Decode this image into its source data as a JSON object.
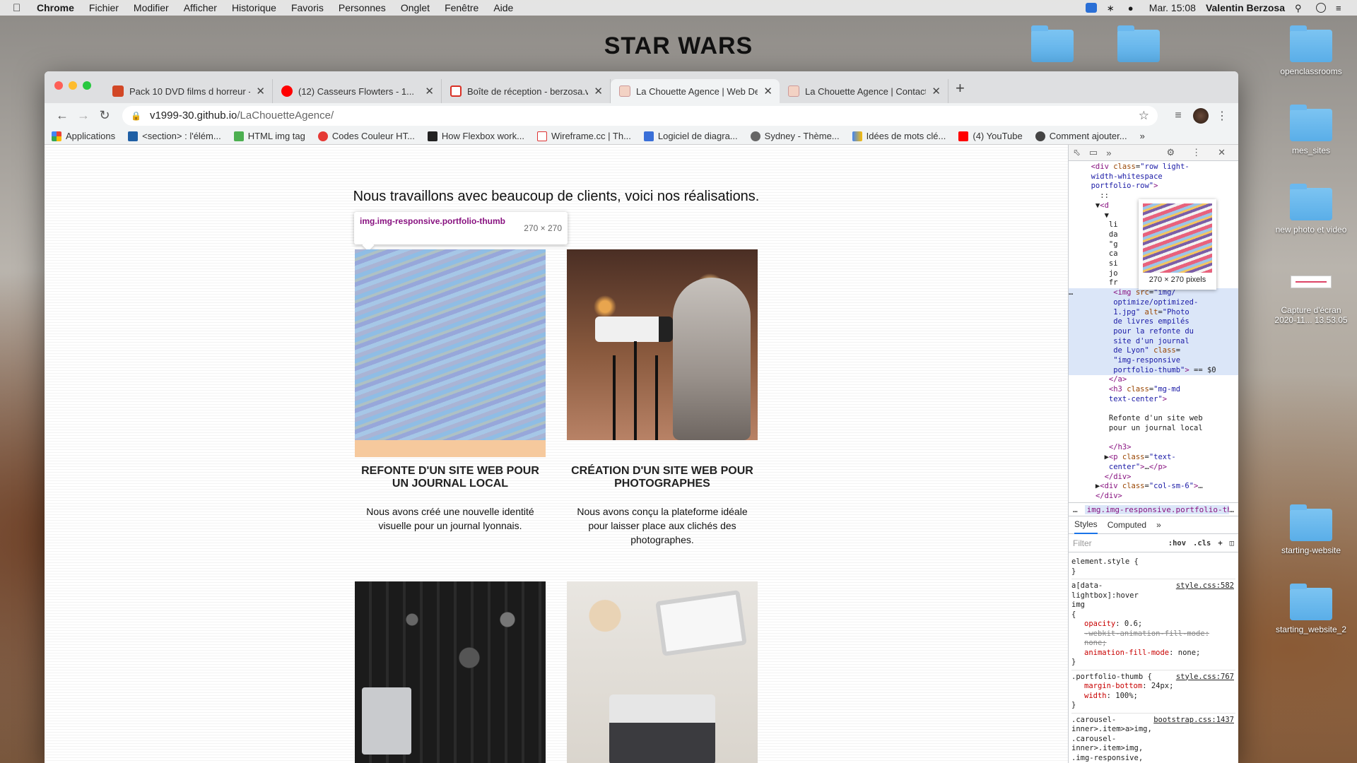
{
  "menubar": {
    "app": "Chrome",
    "items": [
      "Fichier",
      "Modifier",
      "Afficher",
      "Historique",
      "Favoris",
      "Personnes",
      "Onglet",
      "Fenêtre",
      "Aide"
    ],
    "clock": "Mar. 15:08",
    "user": "Valentin Berzosa"
  },
  "desktop": {
    "banner": "STAR WARS",
    "icons": [
      "openclassrooms",
      "mes_sites",
      "new photo et video",
      "Capture d'écran 2020-11... 13.53.05",
      "starting-website",
      "starting_website_2"
    ]
  },
  "browser": {
    "tabs": [
      {
        "title": "Pack 10 DVD films d horreur - 1",
        "favicon": "ppt"
      },
      {
        "title": "(12) Casseurs Flowters - 1...",
        "favicon": "youtube"
      },
      {
        "title": "Boîte de réception - berzosa.v",
        "favicon": "gmail"
      },
      {
        "title": "La Chouette Agence | Web De",
        "favicon": "owl"
      },
      {
        "title": "La Chouette Agence | Contact",
        "favicon": "owl"
      }
    ],
    "url_host": "v1999-30.github.io",
    "url_path": "/LaChouetteAgence/",
    "bookmarks": [
      "Applications",
      "<section> : l'élém...",
      "HTML img tag",
      "Codes Couleur HT...",
      "How Flexbox work...",
      "Wireframe.cc | Th...",
      "Logiciel de diagra...",
      "Sydney - Thème...",
      "Idées de mots clé...",
      "(4) YouTube",
      "Comment ajouter..."
    ]
  },
  "page": {
    "heading": "Nous travaillons avec beaucoup de clients, voici nos réalisations.",
    "hint": {
      "selector": "img.img-responsive.portfolio-thumb",
      "size": "270 × 270"
    },
    "cards": [
      {
        "title": "REFONTE D'UN SITE WEB POUR UN JOURNAL LOCAL",
        "text": "Nous avons créé une nouvelle identité visuelle pour un journal lyonnais."
      },
      {
        "title": "CRÉATION D'UN SITE WEB POUR PHOTOGRAPHES",
        "text": "Nous avons conçu la plateforme idéale pour laisser place aux clichés des photographes."
      }
    ]
  },
  "devtools": {
    "preview_size": "270 × 270 pixels",
    "breadcrumb": "img.img-responsive.portfolio-thur",
    "pane_tabs": [
      "Styles",
      "Computed"
    ],
    "filter_placeholder": "Filter",
    "filter_buttons": [
      ":hov",
      ".cls"
    ],
    "rules": [
      {
        "selector": "element.style {",
        "source": "",
        "props": []
      },
      {
        "selector": "a[data-lightbox]:hover img",
        "source": "style.css:582",
        "props": [
          {
            "name": "opacity",
            "value": "0.6;",
            "struck": false
          },
          {
            "name": "-webkit-animation-fill-mode",
            "value": "none;",
            "struck": true
          },
          {
            "name": "animation-fill-mode",
            "value": "none;",
            "struck": false
          }
        ]
      },
      {
        "selector": ".portfolio-thumb {",
        "source": "style.css:767",
        "props": [
          {
            "name": "margin-bottom",
            "value": "24px;",
            "struck": false
          },
          {
            "name": "width",
            "value": "100%;",
            "struck": false
          }
        ]
      },
      {
        "selector": ".carousel-inner>.item>a>img, .carousel-inner>.item>img, .img-responsive, .thumbnail a>img, .thumbnail>img {",
        "source": "bootstrap.css:1437",
        "props": []
      }
    ]
  }
}
